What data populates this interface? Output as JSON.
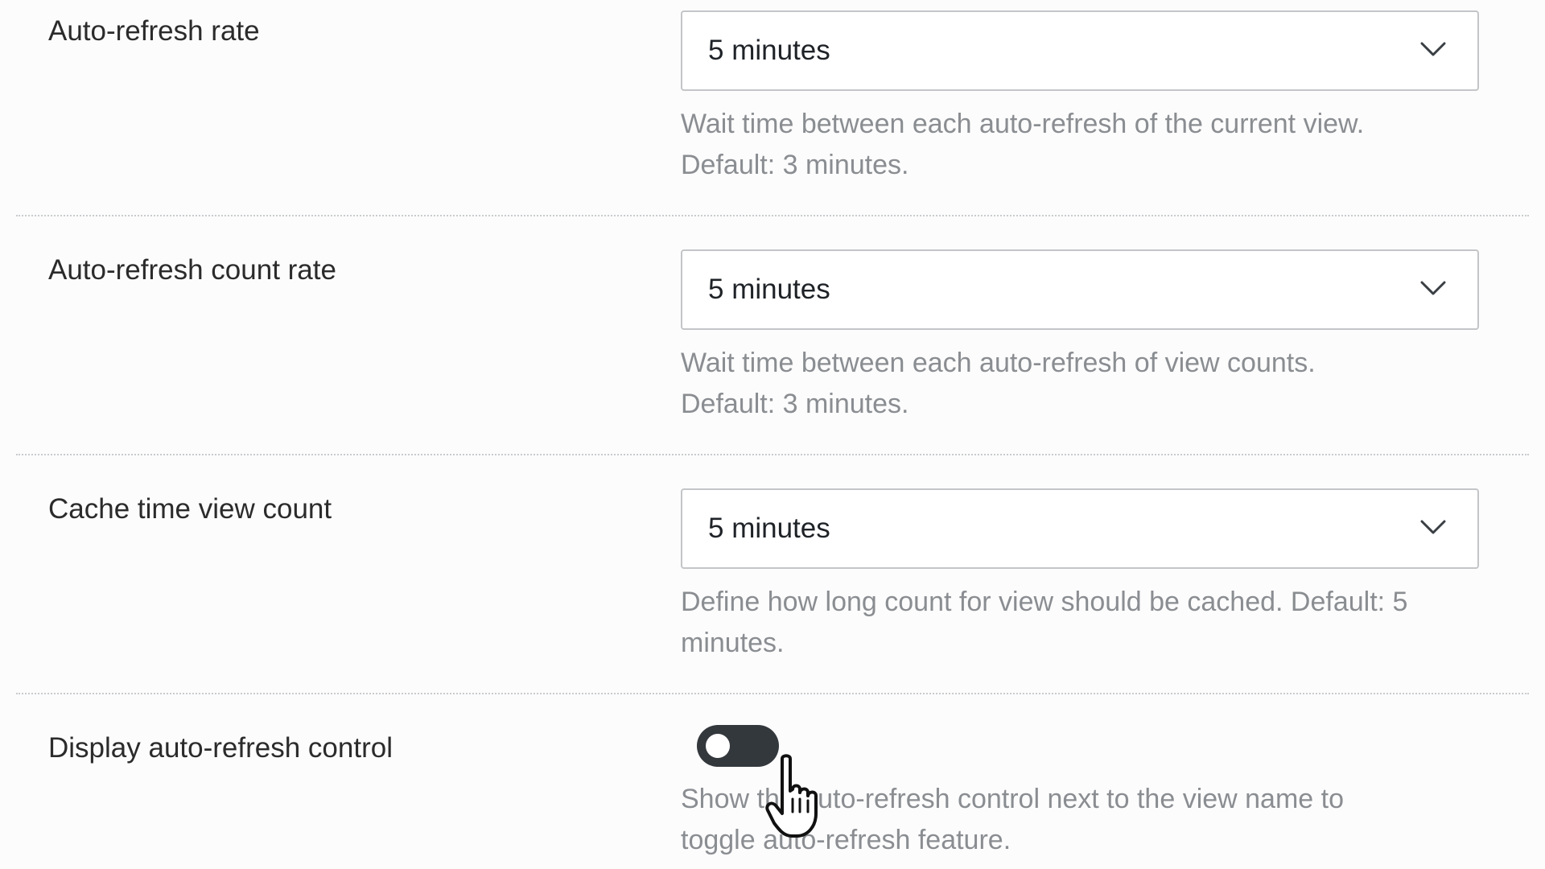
{
  "settings": {
    "auto_refresh_rate": {
      "label": "Auto-refresh rate",
      "value": "5 minutes",
      "help_line1": "Wait time between each auto-refresh of the current view.",
      "help_line2": "Default: 3 minutes."
    },
    "auto_refresh_count_rate": {
      "label": "Auto-refresh count rate",
      "value": "5 minutes",
      "help_line1": "Wait time between each auto-refresh of view counts.",
      "help_line2": "Default: 3 minutes."
    },
    "cache_time_view_count": {
      "label": "Cache time view count",
      "value": "5 minutes",
      "help_line1": "Define how long count for view should be cached. Default: 5",
      "help_line2": "minutes."
    },
    "display_auto_refresh_control": {
      "label": "Display auto-refresh control",
      "enabled": false,
      "help_line1": "Show the auto-refresh control next to the view name to",
      "help_line2": "toggle auto-refresh feature."
    }
  },
  "icons": {
    "select_indicator": "chevron-down-icon",
    "pointer": "hand-pointer-cursor"
  },
  "colors": {
    "toggle_track": "#33383d",
    "toggle_knob": "#ffffff",
    "help_text": "#8a8d91",
    "label_text": "#2b2b2b"
  }
}
